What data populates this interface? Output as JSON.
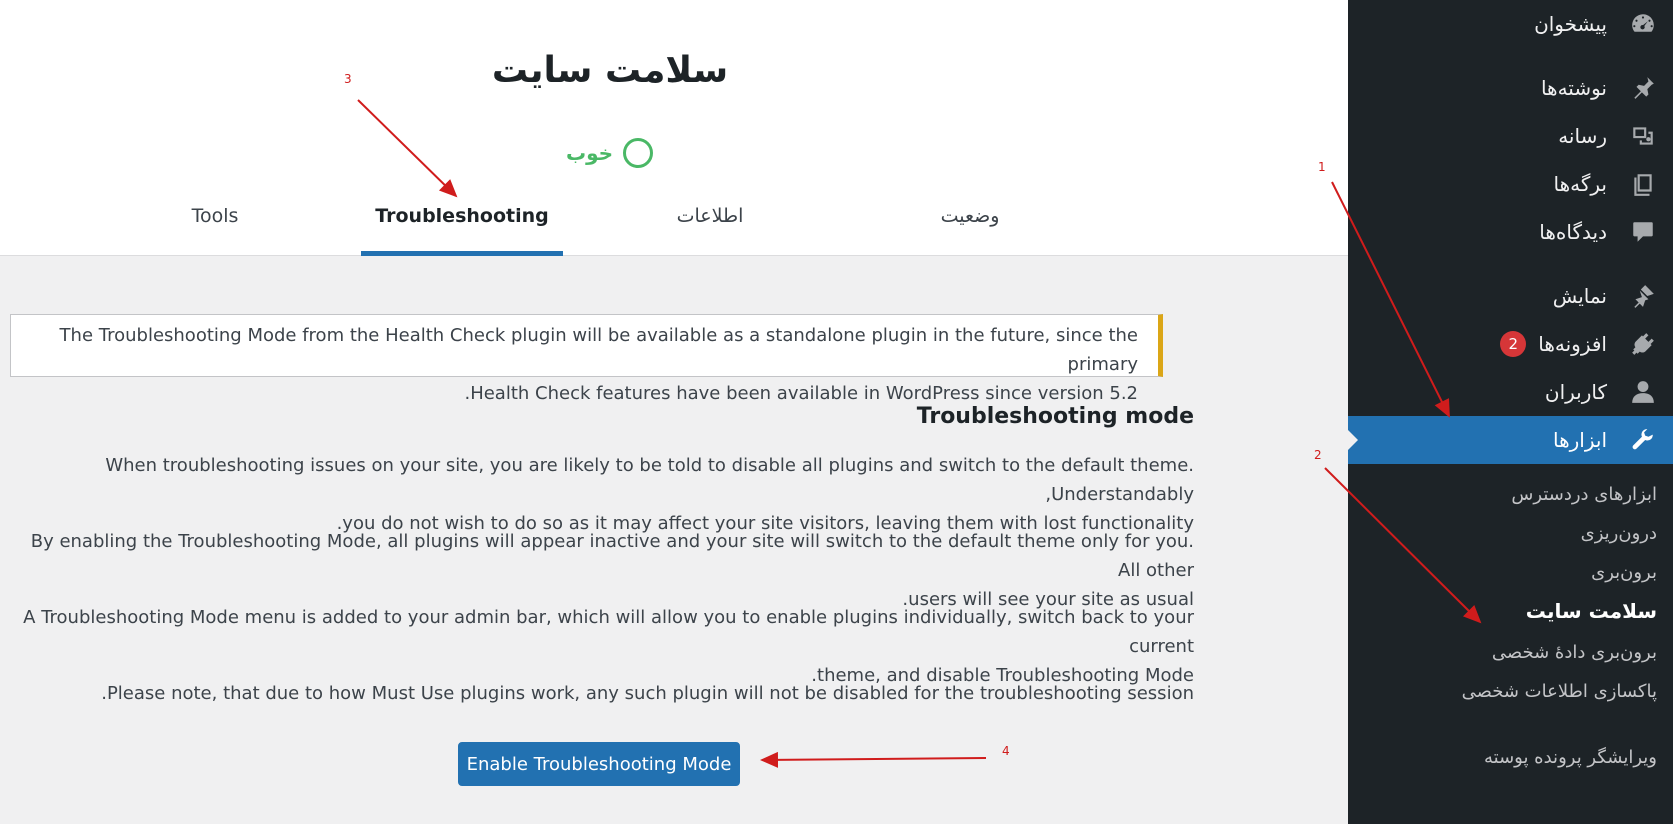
{
  "sidebar": {
    "items": [
      {
        "label": "پیشخوان",
        "icon": "dashboard-icon"
      },
      {
        "label": "نوشته‌ها",
        "icon": "pin-icon"
      },
      {
        "label": "رسانه",
        "icon": "media-icon"
      },
      {
        "label": "برگه‌ها",
        "icon": "pages-icon"
      },
      {
        "label": "دیدگاه‌ها",
        "icon": "comments-icon"
      },
      {
        "label": "نمایش",
        "icon": "appearance-icon"
      },
      {
        "label": "افزونه‌ها",
        "icon": "plugins-icon",
        "badge": "2"
      },
      {
        "label": "کاربران",
        "icon": "users-icon"
      },
      {
        "label": "ابزارها",
        "icon": "tools-icon",
        "active": true
      }
    ],
    "submenu": [
      {
        "label": "ابزارهای دردسترس"
      },
      {
        "label": "درون‌ریزی"
      },
      {
        "label": "برون‌بری"
      },
      {
        "label": "سلامت سایت",
        "current": true
      },
      {
        "label": "برون‌بری دادهٔ شخصی"
      },
      {
        "label": "پاکسازی اطلاعات شخصی"
      },
      {
        "label": "ویرایشگر پرونده پوسته"
      }
    ]
  },
  "header": {
    "title": "سلامت سایت",
    "status": "خوب",
    "tabs": [
      {
        "label": "وضعیت"
      },
      {
        "label": "اطلاعات"
      },
      {
        "label": "Troubleshooting",
        "active": true
      },
      {
        "label": "Tools"
      }
    ]
  },
  "notice": {
    "line1": "The Troubleshooting Mode from the Health Check plugin will be available as a standalone plugin in the future, since the primary",
    "line2": "Health Check features have been available in WordPress since version 5.2."
  },
  "main": {
    "section_title": "Troubleshooting mode",
    "paragraphs": [
      {
        "line1": "When troubleshooting issues on your site, you are likely to be told to disable all plugins and switch to the default theme. Understandably,",
        "line2": "you do not wish to do so as it may affect your site visitors, leaving them with lost functionality."
      },
      {
        "line1": "By enabling the Troubleshooting Mode, all plugins will appear inactive and your site will switch to the default theme only for you. All other",
        "line2": "users will see your site as usual."
      },
      {
        "line1": "A Troubleshooting Mode menu is added to your admin bar, which will allow you to enable plugins individually, switch back to your current",
        "line2": "theme, and disable Troubleshooting Mode."
      },
      {
        "line1": "Please note, that due to how Must Use plugins work, any such plugin will not be disabled for the troubleshooting session.",
        "line2": ""
      }
    ],
    "enable_button": "Enable Troubleshooting Mode"
  },
  "annotations": {
    "a1": "1",
    "a2": "2",
    "a3": "3",
    "a4": "4"
  },
  "colors": {
    "sidebar_bg": "#1d2327",
    "accent": "#2271b1",
    "good": "#4ab866",
    "notice_border": "#dba617",
    "annotation": "#d01c1c"
  }
}
